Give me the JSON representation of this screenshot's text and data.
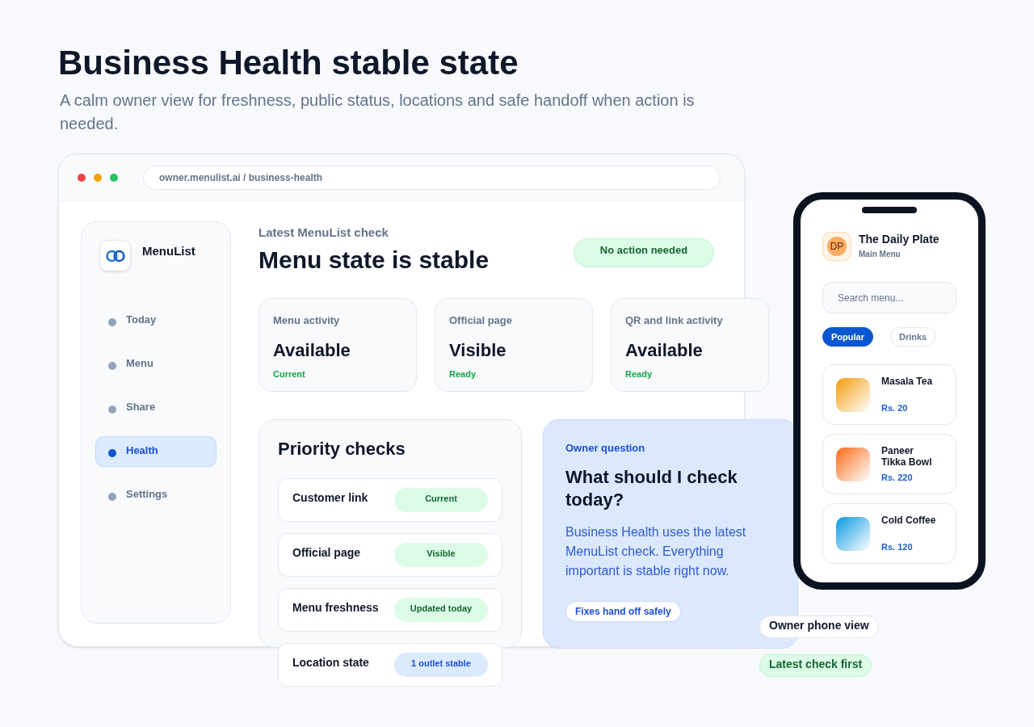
{
  "header": {
    "title": "Business Health stable state",
    "subtitle": "A calm owner view for freshness, public status, locations and safe handoff when action is needed."
  },
  "browser": {
    "url": "owner.menulist.ai / business-health"
  },
  "sidebar": {
    "brand": "MenuList",
    "items": [
      {
        "label": "Today",
        "selected": false
      },
      {
        "label": "Menu",
        "selected": false
      },
      {
        "label": "Share",
        "selected": false
      },
      {
        "label": "Health",
        "selected": true
      },
      {
        "label": "Settings",
        "selected": false
      }
    ]
  },
  "main": {
    "eyebrow": "Latest MenuList check",
    "title": "Menu state is stable",
    "status_badge": "No action needed",
    "stats": [
      {
        "label": "Menu activity",
        "value": "Available",
        "status": "Current"
      },
      {
        "label": "Official page",
        "value": "Visible",
        "status": "Ready"
      },
      {
        "label": "QR and link activity",
        "value": "Available",
        "status": "Ready"
      }
    ],
    "priority_checks": {
      "title": "Priority checks",
      "rows": [
        {
          "label": "Customer link",
          "badge": "Current",
          "kind": "success"
        },
        {
          "label": "Official page",
          "badge": "Visible",
          "kind": "success"
        },
        {
          "label": "Menu freshness",
          "badge": "Updated today",
          "kind": "success"
        },
        {
          "label": "Location state",
          "badge": "1 outlet stable",
          "kind": "info"
        }
      ]
    },
    "owner_question": {
      "eyebrow": "Owner question",
      "title": "What should I check today?",
      "body": "Business Health uses the latest MenuList check. Everything important is stable right now.",
      "chip": "Fixes hand off safely"
    }
  },
  "phone": {
    "restaurant": {
      "initials": "DP",
      "name": "The Daily Plate",
      "subtitle": "Main Menu"
    },
    "search": {
      "placeholder": "Search menu..."
    },
    "tabs": [
      {
        "label": "Popular",
        "selected": true
      },
      {
        "label": "Drinks",
        "selected": false
      }
    ],
    "items": [
      {
        "name": "Masala Tea",
        "price": "Rs. 20",
        "color": "#f4a623"
      },
      {
        "name": "Paneer Tikka Bowl",
        "price": "Rs. 220",
        "color": "#f97a2e"
      },
      {
        "name": "Cold Coffee",
        "price": "Rs. 120",
        "color": "#1fa3e6"
      }
    ]
  },
  "tags": [
    {
      "label": "Owner phone view",
      "kind": "neutral"
    },
    {
      "label": "Latest check first",
      "kind": "success"
    }
  ]
}
